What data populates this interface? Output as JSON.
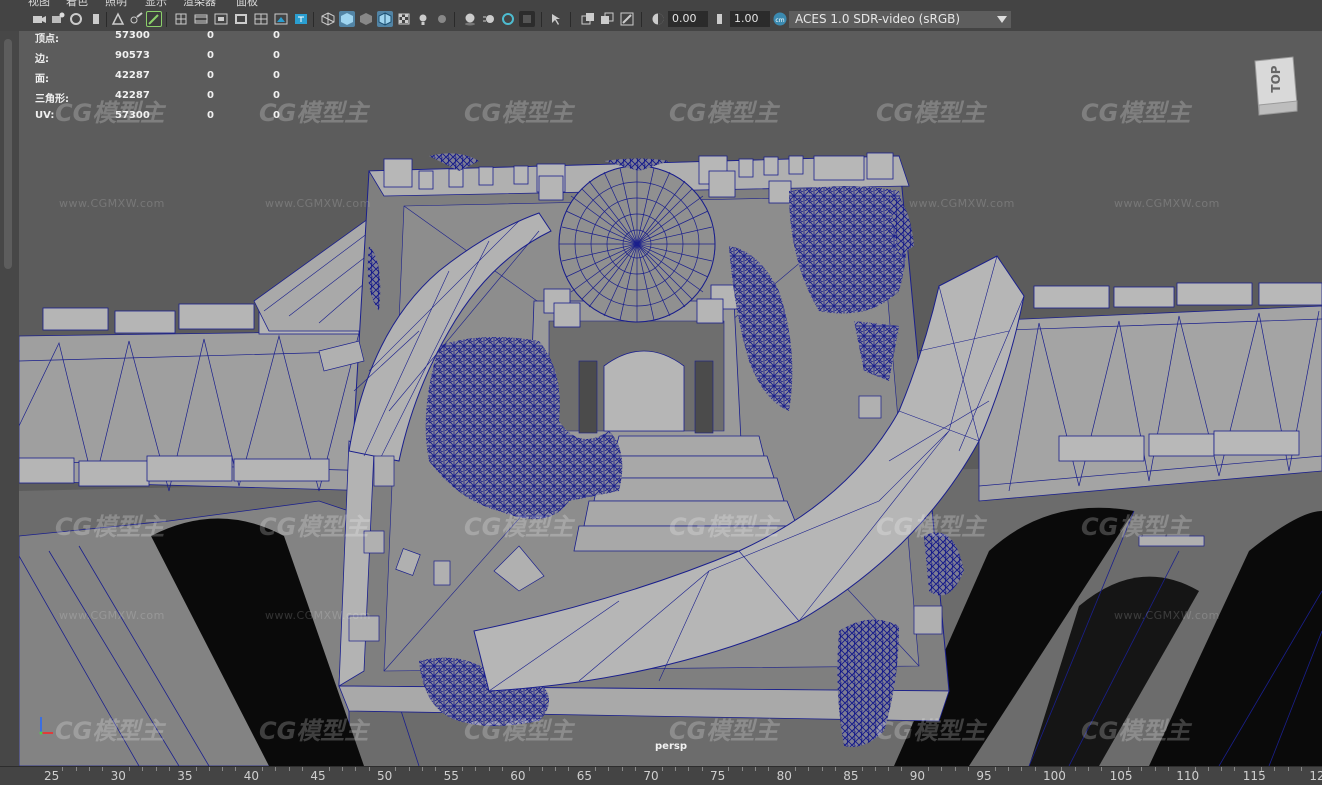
{
  "menu": {
    "items": [
      "视图",
      "着色",
      "照明",
      "显示",
      "渲染器",
      "面板"
    ]
  },
  "toolbar": {
    "exposure_value": "0.00",
    "gamma_value": "1.00",
    "color_management": "ACES 1.0 SDR-video (sRGB)"
  },
  "hud": {
    "rows": [
      {
        "label": "顶点:",
        "total": "57300",
        "sel1": "0",
        "sel2": "0"
      },
      {
        "label": "边:",
        "total": "90573",
        "sel1": "0",
        "sel2": "0"
      },
      {
        "label": "面:",
        "total": "42287",
        "sel1": "0",
        "sel2": "0"
      },
      {
        "label": "三角形:",
        "total": "42287",
        "sel1": "0",
        "sel2": "0"
      },
      {
        "label": "UV:",
        "total": "57300",
        "sel1": "0",
        "sel2": "0"
      }
    ]
  },
  "viewport": {
    "camera_label": "persp",
    "watermark_logo": "CG模型主",
    "watermark_url": "www.CGMXW.com"
  },
  "viewcube": {
    "face_label": "TOP"
  },
  "timeline": {
    "ticks": [
      "25",
      "30",
      "35",
      "40",
      "45",
      "50",
      "55",
      "60",
      "65",
      "70",
      "75",
      "80",
      "85",
      "90",
      "95",
      "100",
      "105",
      "110",
      "115",
      "12"
    ]
  },
  "colors": {
    "viewport_bg": "#5c5c5c",
    "wireframe": "#1a1f8c",
    "mesh_face": "#a9a9a9",
    "ui_panel": "#444444",
    "highlight": "#5284a5"
  }
}
